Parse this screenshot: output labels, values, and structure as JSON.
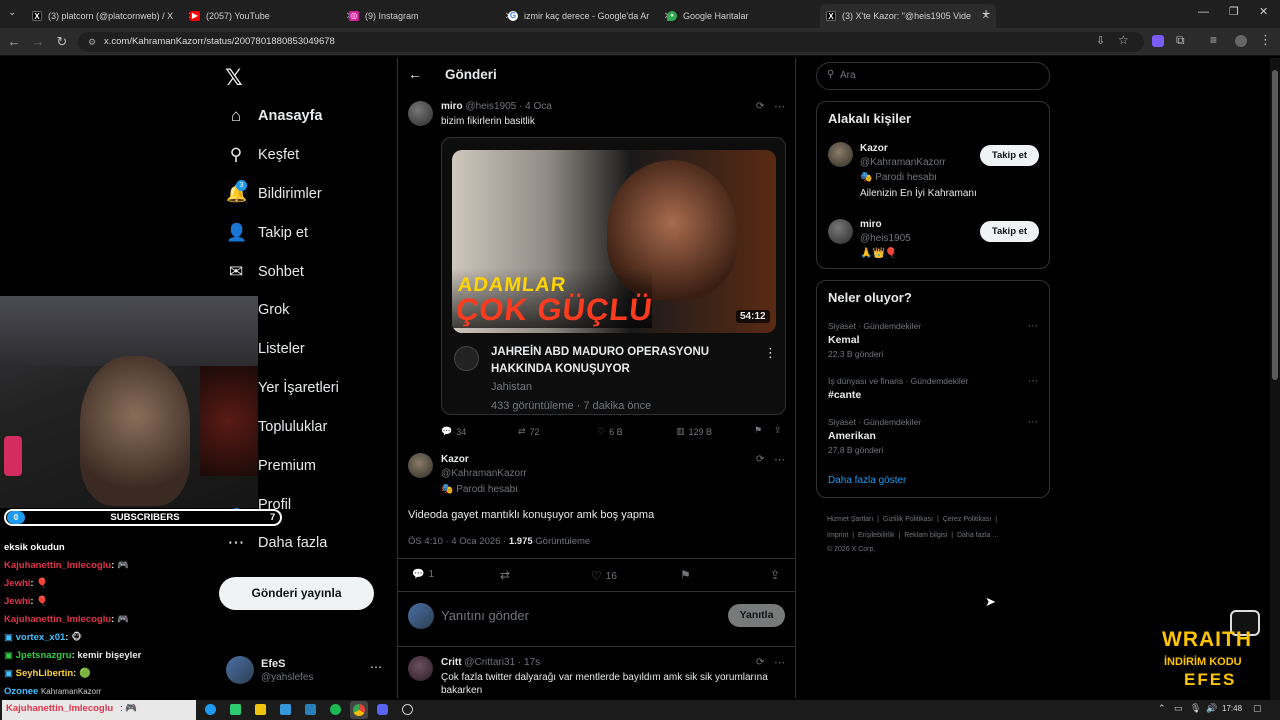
{
  "browser": {
    "tabs": [
      {
        "title": "(3) platcorn (@platcornweb) / X",
        "icon": "x-logo",
        "color": "#000000"
      },
      {
        "title": "(2057) YouTube",
        "icon": "youtube-logo",
        "color": "#ff0000"
      },
      {
        "title": "(9) Instagram",
        "icon": "instagram-logo",
        "color": "#d6249f"
      },
      {
        "title": "izmir kaç derece - Google'da Ar",
        "icon": "google-logo",
        "color": "#4285f4"
      },
      {
        "title": "Google Haritalar",
        "icon": "maps-logo",
        "color": "#34a853"
      },
      {
        "title": "(3) X'te Kazor: \"@heis1905 Vide",
        "icon": "x-logo",
        "color": "#000000"
      }
    ],
    "url": "x.com/KahramanKazorr/status/2007801880853049678"
  },
  "nav": {
    "items": [
      {
        "label": "Anasayfa",
        "icon": "home-icon",
        "glyph": "⌂"
      },
      {
        "label": "Keşfet",
        "icon": "search-icon",
        "glyph": "⚲"
      },
      {
        "label": "Bildirimler",
        "icon": "bell-icon",
        "glyph": "🔔",
        "badge": "3"
      },
      {
        "label": "Takip et",
        "icon": "person-add-icon",
        "glyph": "👤"
      },
      {
        "label": "Sohbet",
        "icon": "mail-icon",
        "glyph": "✉"
      },
      {
        "label": "Grok",
        "icon": "grok-icon",
        "glyph": "◪"
      },
      {
        "label": "Listeler",
        "icon": "list-icon",
        "glyph": "☰"
      },
      {
        "label": "Yer İşaretleri",
        "icon": "bookmark-icon",
        "glyph": "⚑"
      },
      {
        "label": "Topluluklar",
        "icon": "community-icon",
        "glyph": "👥"
      },
      {
        "label": "Premium",
        "icon": "premium-icon",
        "glyph": "✕"
      },
      {
        "label": "Profil",
        "icon": "profile-icon",
        "glyph": "👤"
      },
      {
        "label": "Daha fazla",
        "icon": "more-circle-icon",
        "glyph": "⋯"
      }
    ],
    "post_button": "Gönderi yayınla",
    "account": {
      "name": "EfeS",
      "handle": "@yahslefes"
    }
  },
  "header": {
    "title": "Gönderi"
  },
  "parent_post": {
    "name": "miro",
    "handle": "@heis1905",
    "time": "4 Oca",
    "text": "bizim fikirlerin basitlik",
    "video": {
      "thumb_top": "ADAMLAR",
      "thumb_bottom": "ÇOK GÜÇLÜ",
      "duration": "54:12",
      "title": "JAHREİN ABD MADURO OPERASYONU HAKKINDA KONUŞUYOR",
      "channel": "Jahistan",
      "stats": "433 görüntüleme · 7 dakika önce"
    },
    "actions": {
      "replies": "34",
      "reposts": "72",
      "likes": "6 B",
      "views": "129 B"
    }
  },
  "main_post": {
    "name": "Kazor",
    "handle": "@KahramanKazorr",
    "label": "Parodi hesabı",
    "text": "Videoda gayet mantıklı konuşuyor amk boş yapma",
    "time": "ÖS 4:10 · 4 Oca 2026 ·",
    "views_count": "1.975",
    "views_label": "Görüntüleme",
    "actions": {
      "replies": "1",
      "likes": "16"
    }
  },
  "reply_box": {
    "placeholder": "Yanıtını gönder",
    "button": "Yanıtla"
  },
  "reply_post": {
    "name": "Critt",
    "handle": "@Crittari31",
    "time": "17s",
    "text": "Çok fazla twitter dalyarağı var mentlerde bayıldım amk sik sik yorumlarına bakarken"
  },
  "search": {
    "placeholder": "Ara"
  },
  "related": {
    "title": "Alakalı kişiler",
    "people": [
      {
        "name": "Kazor",
        "handle": "@KahramanKazorr",
        "label": "Parodi hesabı",
        "bio": "Ailenizin En İyi Kahramanı",
        "button": "Takip et"
      },
      {
        "name": "miro",
        "handle": "@heis1905",
        "bio": "🙏👑🎈",
        "button": "Takip et"
      }
    ]
  },
  "trends": {
    "title": "Neler oluyor?",
    "items": [
      {
        "category": "Siyaset · Gündemdekiler",
        "name": "Kemal",
        "count": "22,3 B gönderi"
      },
      {
        "category": "İş dünyası ve finans · Gündemdekiler",
        "name": "#cante",
        "count": ""
      },
      {
        "category": "Siyaset · Gündemdekiler",
        "name": "Amerikan",
        "count": "27,8 B gönderi"
      }
    ],
    "more": "Daha fazla göster"
  },
  "footer": {
    "links1": [
      "Hizmet Şartları",
      "Gizlilik Politikası",
      "Çerez Politikası"
    ],
    "links2": [
      "Imprint",
      "Erişilebilirlik",
      "Reklam bilgisi",
      "Daha fazla ..."
    ],
    "copyright": "© 2026 X Corp."
  },
  "stream": {
    "subs_left": "0",
    "subs_label": "SUBSCRIBERS",
    "subs_right": "7",
    "chat": [
      {
        "user": "eksik okudun",
        "msg": "",
        "color": "#ffffff"
      },
      {
        "user": "Kajuhanettin_lmlecoglu",
        "msg": ": 🎮",
        "color": "#e0334a"
      },
      {
        "user": "Jewhi",
        "msg": ": 🎈",
        "color": "#e0334a"
      },
      {
        "user": "Jewhi",
        "msg": ": 🎈",
        "color": "#e0334a"
      },
      {
        "user": "Kajuhanettin_lmlecoglu",
        "msg": ": 🎮",
        "color": "#e0334a"
      },
      {
        "user": "vortex_x01",
        "msg": ": 🐵",
        "color": "#3fc0ff"
      },
      {
        "user": "Jpetsnazgru",
        "msg": ": kemir bişeyler",
        "color": "#2ecc40"
      },
      {
        "user": "SeyhLibertin",
        "msg": ": 🟢",
        "color": "#ffd23f"
      },
      {
        "user": "Ozonee",
        "msg": "",
        "color": "#3fc0ff"
      },
      {
        "user": "Kajuhanettin_lmlecoglu",
        "msg": ": 🎮",
        "color": "#e0334a"
      }
    ],
    "chat_extra": "KahramanKazorr",
    "promo_line1": "WRAITH",
    "promo_line2": "İNDİRİM KODU",
    "promo_line3": "EFES"
  },
  "taskbar": {
    "time": "17:48"
  },
  "colors": {
    "accent": "#1d9bf0",
    "bg": "#000000",
    "border": "#2f3336"
  }
}
